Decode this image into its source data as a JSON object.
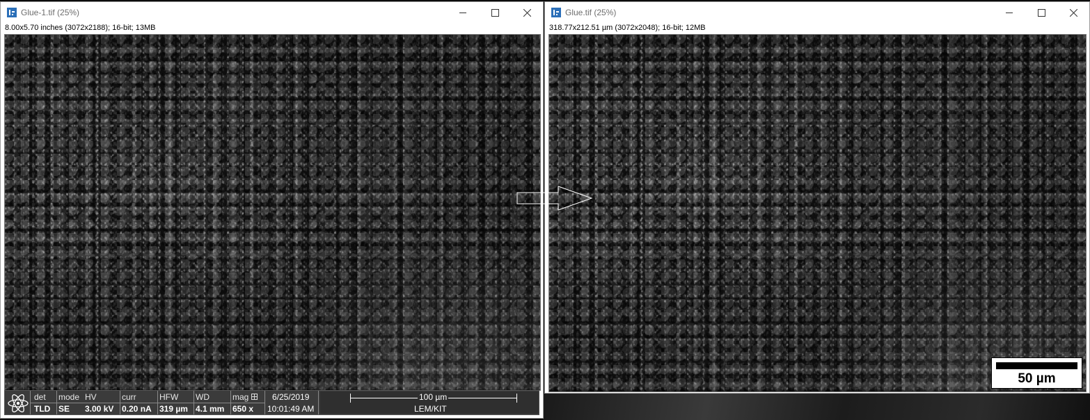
{
  "left_window": {
    "title": "Glue-1.tif (25%)",
    "subtitle": "8.00x5.70 inches (3072x2188); 16-bit; 13MB",
    "sem_info": {
      "det_header": "det",
      "det_value": "TLD",
      "mode_header": "mode",
      "mode_value": "SE",
      "hv_header": "HV",
      "hv_value": "3.00 kV",
      "curr_header": "curr",
      "curr_value": "0.20 nA",
      "hfw_header": "HFW",
      "hfw_value": "319 µm",
      "wd_header": "WD",
      "wd_value": "4.1 mm",
      "mag_header": "mag",
      "mag_value": "650 x",
      "date": "6/25/2019",
      "time": "10:01:49 AM",
      "scale_label": "100 µm",
      "institution": "LEM/KIT"
    }
  },
  "right_window": {
    "title": "Glue.tif (25%)",
    "subtitle": "318.77x212.51 µm (3072x2048); 16-bit; 12MB",
    "scale_bar_label": "50 µm"
  },
  "window_controls": {
    "minimize_icon": "minimize-icon",
    "maximize_icon": "maximize-icon",
    "close_icon": "close-icon"
  },
  "colors": {
    "titlebar_bg": "#ffffff",
    "app_icon": "#2b6fb8",
    "info_bar_bg": "#3b3b3b"
  }
}
